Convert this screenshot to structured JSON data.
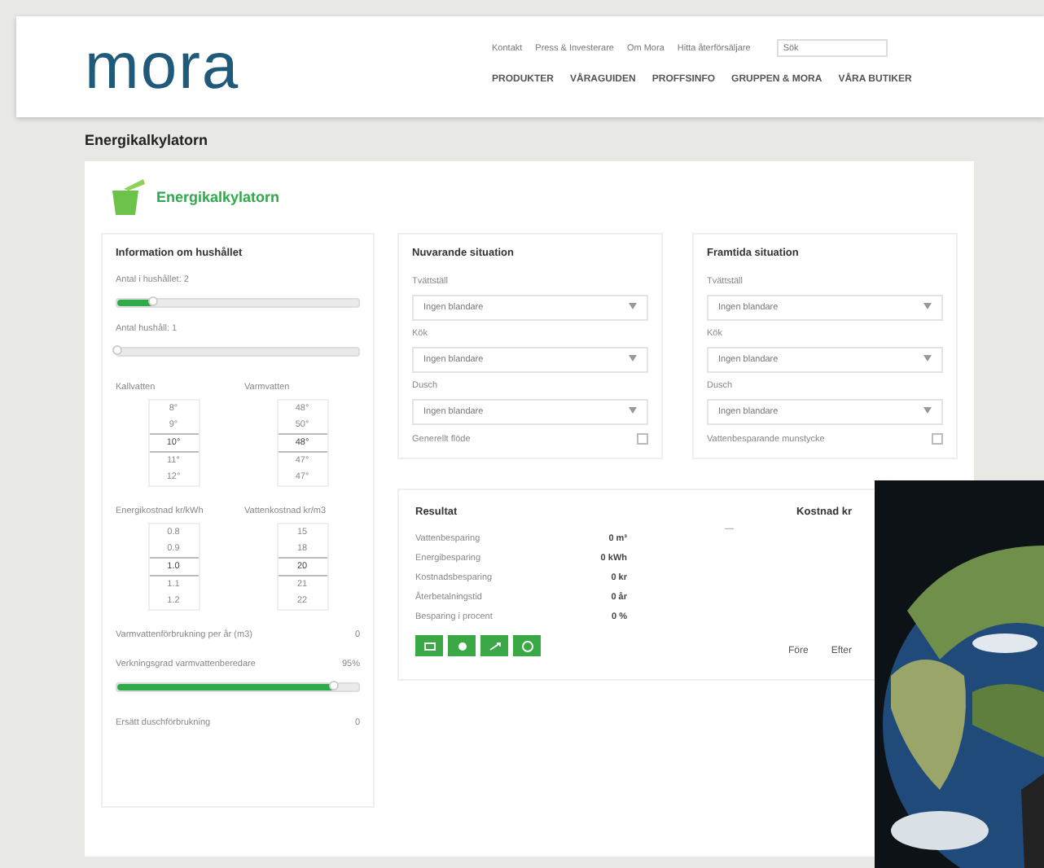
{
  "header": {
    "logo": "mora",
    "top_links": [
      "Kontakt",
      "Press & Investerare",
      "Om Mora",
      "Hitta återförsäljare"
    ],
    "search": {
      "placeholder": "Sök"
    },
    "nav": [
      "PRODUKTER",
      "VÅRAGUIDEN",
      "PROFFSINFO",
      "GRUPPEN & MORA",
      "VÅRA BUTIKER"
    ]
  },
  "page_title": "Energikalkylatorn",
  "calculator": {
    "title": "Energikalkylatorn",
    "household": {
      "title": "Information om hushållet",
      "sliders": [
        {
          "label": "Antal i hushållet: 2",
          "level": 0.15
        },
        {
          "label": "Antal hushåll: 1",
          "level": 0
        }
      ],
      "tables": [
        {
          "columns": [
            {
              "heading": "Kallvatten",
              "values": [
                {
                  "text": "8°",
                  "selected": false
                },
                {
                  "text": "9°",
                  "selected": false
                },
                {
                  "text": "10°",
                  "selected": true
                },
                {
                  "text": "11°",
                  "selected": false
                },
                {
                  "text": "12°",
                  "selected": false
                }
              ]
            },
            {
              "heading": "Varmvatten",
              "values": [
                {
                  "text": "48°",
                  "selected": false
                },
                {
                  "text": "50°",
                  "selected": false
                },
                {
                  "text": "48°",
                  "selected": true
                },
                {
                  "text": "47°",
                  "selected": false
                },
                {
                  "text": "47°",
                  "selected": false
                }
              ]
            }
          ]
        },
        {
          "columns": [
            {
              "heading": "Energikostnad kr/kWh",
              "values": [
                {
                  "text": "0.8",
                  "selected": false
                },
                {
                  "text": "0.9",
                  "selected": false
                },
                {
                  "text": "1.0",
                  "selected": true
                },
                {
                  "text": "1.1",
                  "selected": false
                },
                {
                  "text": "1.2",
                  "selected": false
                }
              ]
            },
            {
              "heading": "Vattenkostnad kr/m3",
              "values": [
                {
                  "text": "15",
                  "selected": false
                },
                {
                  "text": "18",
                  "selected": false
                },
                {
                  "text": "20",
                  "selected": true
                },
                {
                  "text": "21",
                  "selected": false
                },
                {
                  "text": "22",
                  "selected": false
                }
              ]
            }
          ]
        }
      ],
      "rows": [
        {
          "kind": "value",
          "label": "Varmvattenförbrukning per år (m3)",
          "value": "0"
        },
        {
          "kind": "slider",
          "label": "Verkningsgrad varmvattenberedare",
          "value": "95%",
          "level": 0.9
        },
        {
          "kind": "value",
          "label": "Ersätt duschförbrukning",
          "value": "0"
        }
      ]
    },
    "situations": [
      {
        "title": "Nuvarande situation",
        "fields": [
          {
            "label": "Tvättställ",
            "value": "Ingen blandare"
          },
          {
            "label": "Kök",
            "value": "Ingen blandare"
          },
          {
            "label": "Dusch",
            "value": "Ingen blandare"
          }
        ],
        "option": {
          "label": "Generellt flöde",
          "checked": false
        }
      },
      {
        "title": "Framtida situation",
        "fields": [
          {
            "label": "Tvättställ",
            "value": "Ingen blandare"
          },
          {
            "label": "Kök",
            "value": "Ingen blandare"
          },
          {
            "label": "Dusch",
            "value": "Ingen blandare"
          }
        ],
        "option": {
          "label": "Vattenbesparande munstycke",
          "checked": false
        }
      }
    ],
    "result": {
      "title": "Resultat",
      "rows": [
        {
          "label": "Vattenbesparing",
          "value": "0 m³"
        },
        {
          "label": "Energibesparing",
          "value": "0 kWh"
        },
        {
          "label": "Kostnadsbesparing",
          "value": "0 kr"
        },
        {
          "label": "Återbetalningstid",
          "value": "0 år"
        },
        {
          "label": "Besparing i procent",
          "value": "0 %"
        }
      ],
      "cost_heading": "Kostnad kr",
      "cost_dash": "—",
      "cost_labels": [
        "Före",
        "Efter"
      ]
    }
  }
}
